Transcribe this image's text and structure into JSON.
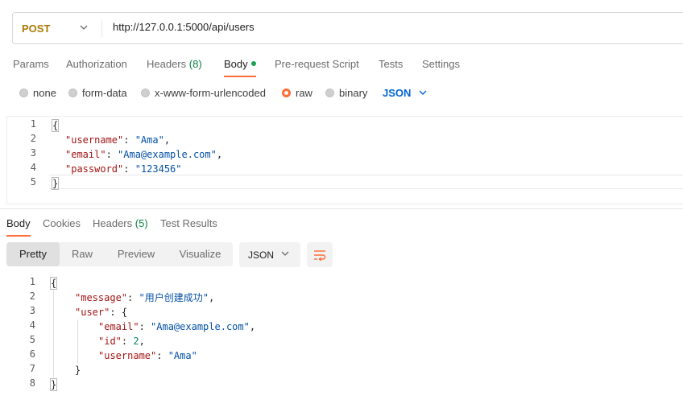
{
  "request": {
    "method": "POST",
    "url": "http://127.0.0.1:5000/api/users"
  },
  "request_tabs": [
    {
      "label": "Params"
    },
    {
      "label": "Authorization"
    },
    {
      "label": "Headers",
      "count": "(8)"
    },
    {
      "label": "Body",
      "active": true
    },
    {
      "label": "Pre-request Script"
    },
    {
      "label": "Tests"
    },
    {
      "label": "Settings"
    }
  ],
  "body_types": [
    {
      "label": "none",
      "selected": false
    },
    {
      "label": "form-data",
      "selected": false
    },
    {
      "label": "x-www-form-urlencoded",
      "selected": false
    },
    {
      "label": "raw",
      "selected": true
    },
    {
      "label": "binary",
      "selected": false
    }
  ],
  "raw_format": "JSON",
  "request_body": {
    "line_numbers": [
      "1",
      "2",
      "3",
      "4",
      "5"
    ],
    "open_brace": "{",
    "close_brace": "}",
    "fields": [
      {
        "key": "\"username\"",
        "value": "\"Ama\"",
        "sep": ",",
        "colon": ": "
      },
      {
        "key": "\"email\"",
        "value": "\"Ama@example.com\"",
        "sep": ",",
        "colon": ": "
      },
      {
        "key": "\"password\"",
        "value": "\"123456\"",
        "sep": "",
        "colon": ": "
      }
    ]
  },
  "response_tabs": [
    {
      "label": "Body",
      "active": true
    },
    {
      "label": "Cookies"
    },
    {
      "label": "Headers",
      "count": "(5)"
    },
    {
      "label": "Test Results"
    }
  ],
  "view_modes": [
    "Pretty",
    "Raw",
    "Preview",
    "Visualize"
  ],
  "response_format": "JSON",
  "response_body": {
    "line_numbers": [
      "1",
      "2",
      "3",
      "4",
      "5",
      "6",
      "7",
      "8"
    ],
    "open_brace": "{",
    "close_brace": "}",
    "message_key": "\"message\"",
    "message_value": "\"用户创建成功\"",
    "user_key": "\"user\"",
    "user_open": "{",
    "user_close": "}",
    "email_key": "\"email\"",
    "email_value": "\"Ama@example.com\"",
    "id_key": "\"id\"",
    "id_value": "2",
    "username_key": "\"username\"",
    "username_value": "\"Ama\"",
    "colon": ": ",
    "comma": ",",
    "colon_brace": ": "
  },
  "colors": {
    "accent": "#ff6c37",
    "method": "#ad7a03",
    "link_blue": "#0265d2",
    "key_red": "#a31515",
    "string_blue": "#0451a5",
    "number_green": "#098658"
  }
}
